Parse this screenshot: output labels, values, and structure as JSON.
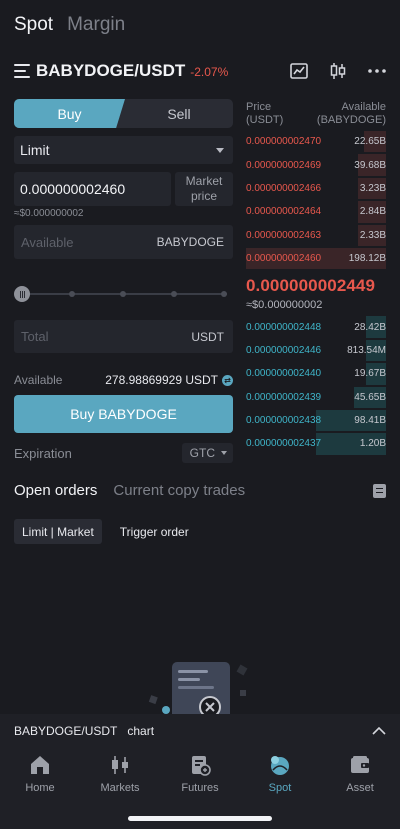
{
  "top_tabs": {
    "spot": "Spot",
    "margin": "Margin"
  },
  "pair": {
    "name": "BABYDOGE/USDT",
    "change": "-2.07%"
  },
  "trade": {
    "buy_label": "Buy",
    "sell_label": "Sell",
    "order_type": "Limit",
    "price_value": "0.000000002460",
    "market_price_label": [
      "Market",
      "price"
    ],
    "price_approx": "≈$0.000000002",
    "available_placeholder": "Available",
    "available_unit": "BABYDOGE",
    "total_placeholder": "Total",
    "total_unit": "USDT",
    "available_label": "Available",
    "available_value": "278.98869929 USDT",
    "buy_button": "Buy BABYDOGE",
    "expiration_label": "Expiration",
    "expiration_value": "GTC"
  },
  "order_book": {
    "header_price": [
      "Price",
      "(USDT)"
    ],
    "header_available": [
      "Available",
      "(BABYDOGE)"
    ],
    "asks": [
      {
        "price": "0.000000002470",
        "qty": "22.65B",
        "depth": 0.16
      },
      {
        "price": "0.000000002469",
        "qty": "39.68B",
        "depth": 0.2
      },
      {
        "price": "0.000000002466",
        "qty": "3.23B",
        "depth": 0.2
      },
      {
        "price": "0.000000002464",
        "qty": "2.84B",
        "depth": 0.2
      },
      {
        "price": "0.000000002463",
        "qty": "2.33B",
        "depth": 0.2
      },
      {
        "price": "0.000000002460",
        "qty": "198.12B",
        "depth": 1.0
      }
    ],
    "last_price": "0.000000002449",
    "last_approx": "≈$0.000000002",
    "bids": [
      {
        "price": "0.000000002448",
        "qty": "28.42B",
        "depth": 0.14
      },
      {
        "price": "0.000000002446",
        "qty": "813.54M",
        "depth": 0.14
      },
      {
        "price": "0.000000002440",
        "qty": "19.67B",
        "depth": 0.14
      },
      {
        "price": "0.000000002439",
        "qty": "45.65B",
        "depth": 0.23
      },
      {
        "price": "0.000000002438",
        "qty": "98.41B",
        "depth": 0.5
      },
      {
        "price": "0.000000002437",
        "qty": "1.20B",
        "depth": 0.5
      }
    ]
  },
  "orders": {
    "tab_open": "Open orders",
    "tab_copy": "Current copy trades",
    "filter_limit_market": "Limit | Market",
    "filter_trigger": "Trigger order"
  },
  "chart_bar": {
    "pair": "BABYDOGE/USDT",
    "label": "chart"
  },
  "nav": [
    {
      "label": "Home",
      "icon": "home-icon"
    },
    {
      "label": "Markets",
      "icon": "markets-icon"
    },
    {
      "label": "Futures",
      "icon": "futures-icon"
    },
    {
      "label": "Spot",
      "icon": "spot-icon",
      "active": true
    },
    {
      "label": "Asset",
      "icon": "wallet-icon"
    }
  ],
  "colors": {
    "accent": "#5aa7c0",
    "ask": "#e8584d",
    "bid": "#3fb5c9",
    "background": "#1a1b20"
  }
}
